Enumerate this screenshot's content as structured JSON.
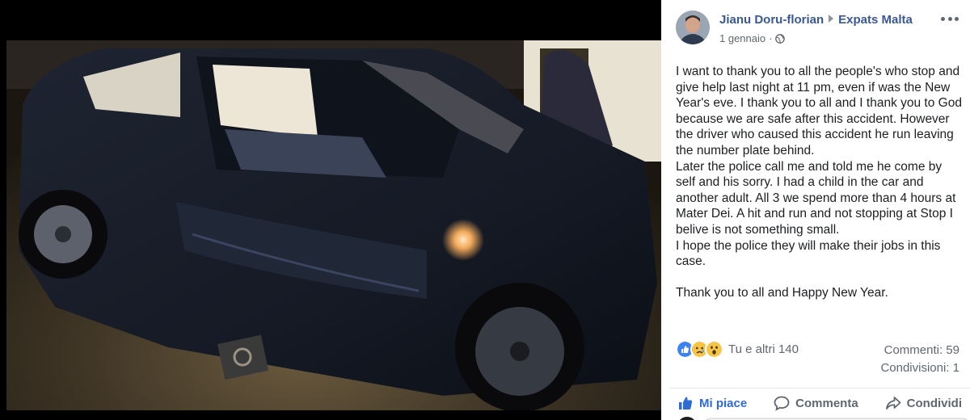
{
  "post": {
    "author": "Jianu Doru-florian",
    "group": "Expats Malta",
    "date": "1 gennaio",
    "separator": "·",
    "paragraphs": [
      "I want to thank you to all the people's who stop and give help last night at 11 pm, even if was the New Year's eve. I thank you to all and I thank you to God because we are safe after this accident. However the driver who caused this accident he run leaving the number plate behind.",
      "Later the police call me and told me he come by self and his sorry. I had a child in the car and another adult. All 3 we spend more than 4 hours at Mater Dei. A hit and run and not stopping at Stop I belive is not something small.",
      "I hope the police they will make their jobs in this case.",
      "Thank you to all and Happy New Year."
    ],
    "reactions_text": "Tu e altri 140",
    "comments_count": "Commenti: 59",
    "shares_count": "Condivisioni: 1",
    "actions": {
      "like": "Mi piace",
      "comment": "Commenta",
      "share": "Condividi"
    }
  },
  "icons": {
    "globe": "globe-icon",
    "more": "more-options-icon",
    "like": "like-icon",
    "sad": "sad-icon",
    "wow": "wow-icon",
    "comment": "comment-icon",
    "share": "share-icon"
  },
  "colors": {
    "link": "#385898",
    "like_active": "#2d6bd8",
    "secondary_text": "#606770",
    "body_text": "#1c1e21"
  }
}
